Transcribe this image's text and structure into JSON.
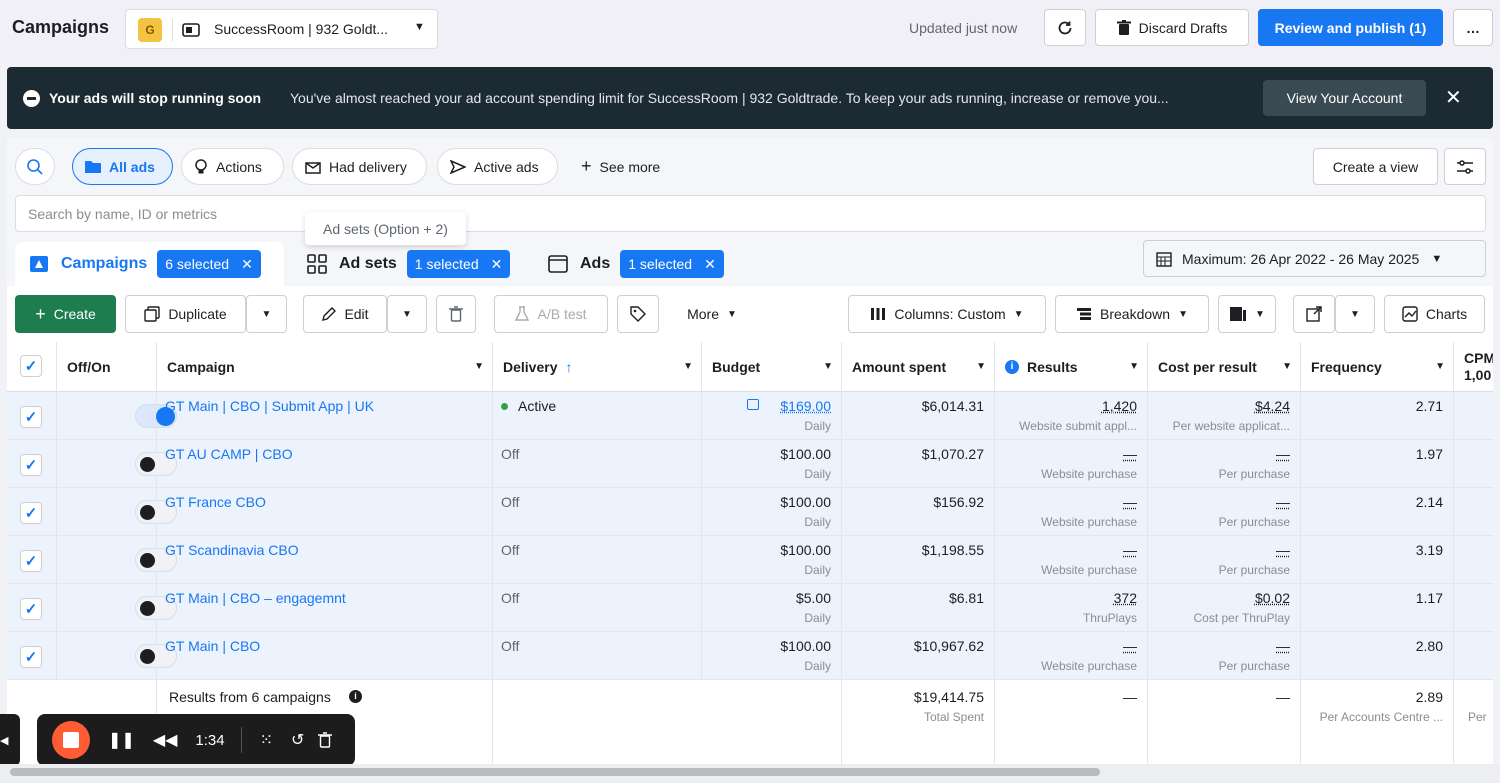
{
  "header": {
    "title": "Campaigns",
    "account_initial": "G",
    "account_name": "SuccessRoom | 932 Goldt...",
    "updated": "Updated just now",
    "discard_label": "Discard Drafts",
    "publish_label": "Review and publish (1)",
    "more_label": "…"
  },
  "alert": {
    "title": "Your ads will stop running soon",
    "message": "You've almost reached your ad account spending limit for SuccessRoom | 932 Goldtrade. To keep your ads running, increase or remove you...",
    "button": "View Your Account",
    "close": "✕"
  },
  "filters": {
    "all_ads": "All ads",
    "actions": "Actions",
    "had_delivery": "Had delivery",
    "active_ads": "Active ads",
    "see_more": "See more",
    "create_view": "Create a view"
  },
  "search": {
    "placeholder": "Search by name, ID or metrics"
  },
  "tooltip": "Ad sets (Option + 2)",
  "tabs": {
    "campaigns": {
      "label": "Campaigns",
      "selected": "6 selected"
    },
    "adsets": {
      "label": "Ad sets",
      "selected": "1 selected"
    },
    "ads": {
      "label": "Ads",
      "selected": "1 selected"
    }
  },
  "date_range": "Maximum: 26 Apr 2022 - 26 May 2025",
  "toolbar": {
    "create": "Create",
    "duplicate": "Duplicate",
    "edit": "Edit",
    "ab_test": "A/B test",
    "more": "More",
    "columns": "Columns: Custom",
    "breakdown": "Breakdown",
    "charts": "Charts"
  },
  "columns": {
    "offon": "Off/On",
    "campaign": "Campaign",
    "delivery": "Delivery",
    "budget": "Budget",
    "amount_spent": "Amount spent",
    "results": "Results",
    "cost_per_result": "Cost per result",
    "frequency": "Frequency",
    "cpm": "CPM",
    "cpm2": "1,00"
  },
  "rows": [
    {
      "name": "GT Main | CBO | Submit App | UK",
      "on": true,
      "delivery": "Active",
      "budget": "$169.00",
      "budget_sub": "Daily",
      "spent": "$6,014.31",
      "results": "1,420",
      "results_sub": "Website submit appl...",
      "cpr": "$4.24",
      "cpr_sub": "Per website applicat...",
      "frequency": "2.71"
    },
    {
      "name": "GT AU CAMP | CBO",
      "on": false,
      "delivery": "Off",
      "budget": "$100.00",
      "budget_sub": "Daily",
      "spent": "$1,070.27",
      "results": "—",
      "results_sub": "Website purchase",
      "cpr": "—",
      "cpr_sub": "Per purchase",
      "frequency": "1.97"
    },
    {
      "name": "GT France CBO",
      "on": false,
      "delivery": "Off",
      "budget": "$100.00",
      "budget_sub": "Daily",
      "spent": "$156.92",
      "results": "—",
      "results_sub": "Website purchase",
      "cpr": "—",
      "cpr_sub": "Per purchase",
      "frequency": "2.14"
    },
    {
      "name": "GT Scandinavia CBO",
      "on": false,
      "delivery": "Off",
      "budget": "$100.00",
      "budget_sub": "Daily",
      "spent": "$1,198.55",
      "results": "—",
      "results_sub": "Website purchase",
      "cpr": "—",
      "cpr_sub": "Per purchase",
      "frequency": "3.19"
    },
    {
      "name": "GT Main | CBO – engagemnt",
      "on": false,
      "delivery": "Off",
      "budget": "$5.00",
      "budget_sub": "Daily",
      "spent": "$6.81",
      "results": "372",
      "results_sub": "ThruPlays",
      "cpr": "$0.02",
      "cpr_sub": "Cost per ThruPlay",
      "frequency": "1.17"
    },
    {
      "name": "GT Main | CBO",
      "on": false,
      "delivery": "Off",
      "budget": "$100.00",
      "budget_sub": "Daily",
      "spent": "$10,967.62",
      "results": "—",
      "results_sub": "Website purchase",
      "cpr": "—",
      "cpr_sub": "Per purchase",
      "frequency": "2.80"
    }
  ],
  "summary": {
    "label": "Results from 6 campaigns",
    "spent": "$19,414.75",
    "spent_sub": "Total Spent",
    "results": "—",
    "cpr": "—",
    "frequency": "2.89",
    "frequency_sub": "Per Accounts Centre ...",
    "cpm_sub": "Per"
  },
  "recorder": {
    "time": "1:34"
  },
  "colors": {
    "primary": "#1877f2",
    "create": "#1e7d4f",
    "alert_bg": "#1c2b33",
    "active": "#31a24c",
    "stop": "#ff5c33"
  }
}
